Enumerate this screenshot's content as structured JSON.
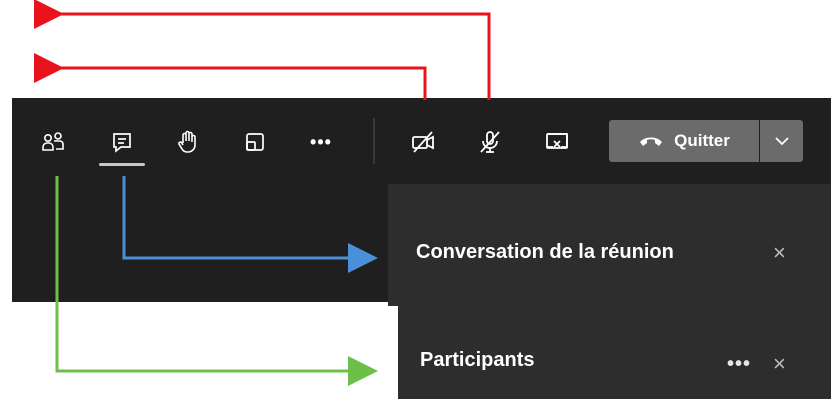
{
  "toolbar": {
    "icons": [
      {
        "name": "participants-icon"
      },
      {
        "name": "chat-icon"
      },
      {
        "name": "raise-hand-icon"
      },
      {
        "name": "rooms-icon"
      },
      {
        "name": "more-actions-icon"
      },
      {
        "name": "camera-off-icon"
      },
      {
        "name": "mic-muted-icon"
      },
      {
        "name": "stop-share-icon"
      }
    ],
    "more_label": "•••",
    "leave_label": "Quitter",
    "leave_color": "#6b6b6b"
  },
  "chat_panel": {
    "title": "Conversation de la réunion",
    "close": "×"
  },
  "participants_panel": {
    "title": "Participants",
    "more": "•••",
    "close": "×"
  },
  "annotation_colors": {
    "red": "#e8131b",
    "blue": "#4a90d9",
    "green": "#6cc04a"
  }
}
